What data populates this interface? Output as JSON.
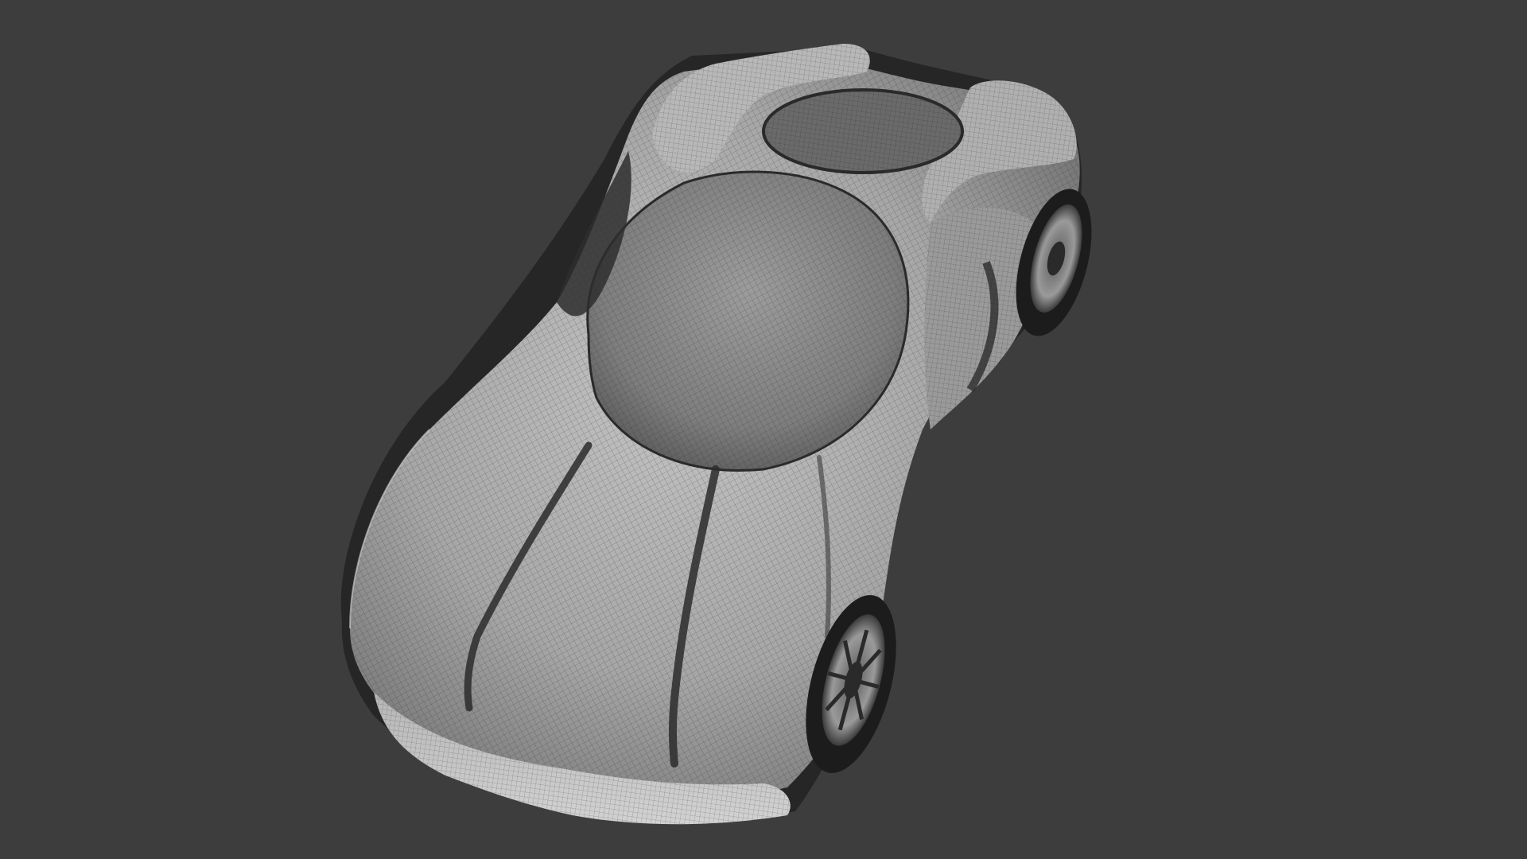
{
  "viewport": {
    "background_color": "#3d3d3d",
    "render_mode": "wireframe-on-shaded",
    "subject": "sports-car-model",
    "colors": {
      "surface_light": "#bdbdbd",
      "surface_mid": "#8f8f8f",
      "surface_dark": "#4a4a4a",
      "wire": "#1e1e1e",
      "tire": "#1c1c1c",
      "rim": "#9a9a9a"
    }
  }
}
